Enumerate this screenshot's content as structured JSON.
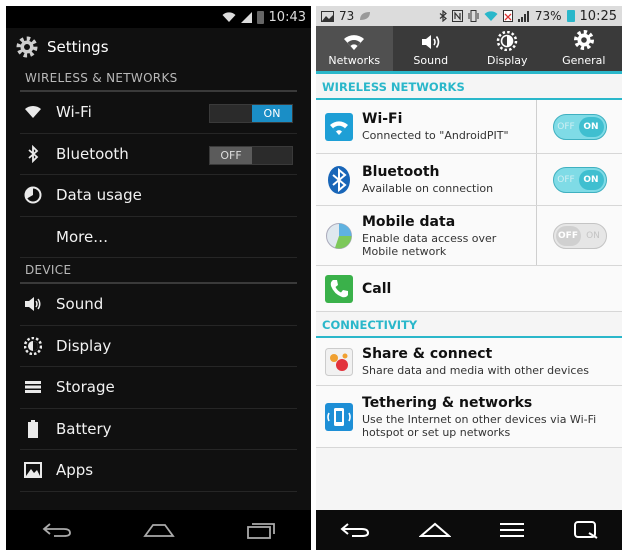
{
  "left": {
    "status": {
      "time": "10:43"
    },
    "title": "Settings",
    "sections": {
      "wireless": "WIRELESS & NETWORKS",
      "device": "DEVICE"
    },
    "wireless_items": {
      "wifi": {
        "label": "Wi-Fi",
        "toggle": "ON"
      },
      "bluetooth": {
        "label": "Bluetooth",
        "toggle": "OFF"
      },
      "data": {
        "label": "Data usage"
      },
      "more": {
        "label": "More…"
      }
    },
    "device_items": {
      "sound": "Sound",
      "display": "Display",
      "storage": "Storage",
      "battery": "Battery",
      "apps": "Apps"
    }
  },
  "right": {
    "status": {
      "notifications": "73",
      "battery": "73%",
      "time": "10:25"
    },
    "tabs": [
      "Networks",
      "Sound",
      "Display",
      "General"
    ],
    "sections": {
      "wireless": "WIRELESS NETWORKS",
      "connectivity": "CONNECTIVITY"
    },
    "items": {
      "wifi": {
        "title": "Wi-Fi",
        "subtitle": "Connected to \"AndroidPIT\"",
        "off": "OFF",
        "on": "ON"
      },
      "bluetooth": {
        "title": "Bluetooth",
        "subtitle": "Available on connection",
        "off": "OFF",
        "on": "ON"
      },
      "mobile": {
        "title": "Mobile data",
        "subtitle": "Enable data access over Mobile network",
        "off": "OFF",
        "on": "ON"
      },
      "call": {
        "title": "Call"
      },
      "share": {
        "title": "Share & connect",
        "subtitle": "Share data and media with other devices"
      },
      "tethering": {
        "title": "Tethering & networks",
        "subtitle": "Use the Internet on other devices via Wi-Fi hotspot or set up networks"
      }
    }
  },
  "colors": {
    "left_accent": "#1a8ec6",
    "right_accent": "#2ab7ca"
  },
  "icons": [
    "wifi-icon",
    "bluetooth-icon",
    "data-usage-icon",
    "sound-icon",
    "display-icon",
    "storage-icon",
    "battery-icon",
    "apps-icon",
    "gear-icon",
    "call-icon",
    "share-icon",
    "tethering-icon",
    "back-icon",
    "home-icon",
    "recents-icon",
    "menu-icon"
  ]
}
